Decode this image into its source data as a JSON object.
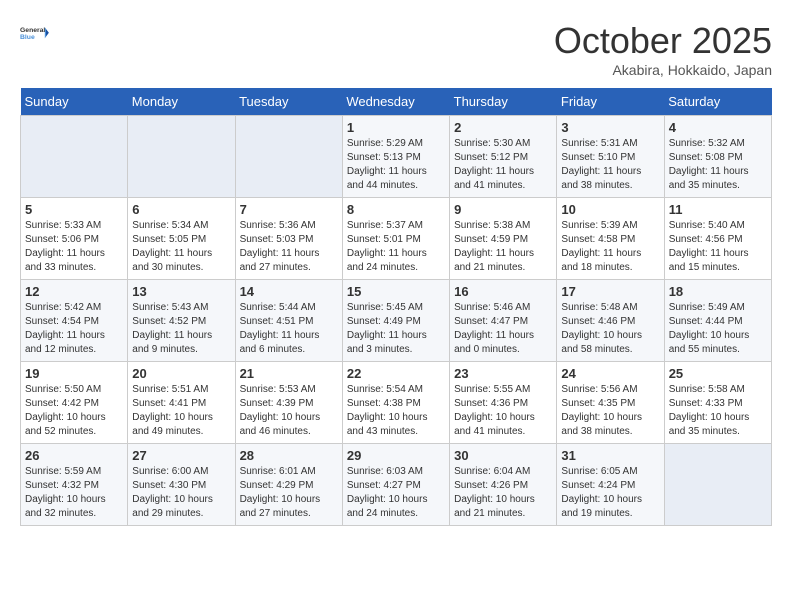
{
  "header": {
    "logo_line1": "General",
    "logo_line2": "Blue",
    "month": "October 2025",
    "location": "Akabira, Hokkaido, Japan"
  },
  "weekdays": [
    "Sunday",
    "Monday",
    "Tuesday",
    "Wednesday",
    "Thursday",
    "Friday",
    "Saturday"
  ],
  "weeks": [
    [
      {
        "day": "",
        "info": ""
      },
      {
        "day": "",
        "info": ""
      },
      {
        "day": "",
        "info": ""
      },
      {
        "day": "1",
        "info": "Sunrise: 5:29 AM\nSunset: 5:13 PM\nDaylight: 11 hours and 44 minutes."
      },
      {
        "day": "2",
        "info": "Sunrise: 5:30 AM\nSunset: 5:12 PM\nDaylight: 11 hours and 41 minutes."
      },
      {
        "day": "3",
        "info": "Sunrise: 5:31 AM\nSunset: 5:10 PM\nDaylight: 11 hours and 38 minutes."
      },
      {
        "day": "4",
        "info": "Sunrise: 5:32 AM\nSunset: 5:08 PM\nDaylight: 11 hours and 35 minutes."
      }
    ],
    [
      {
        "day": "5",
        "info": "Sunrise: 5:33 AM\nSunset: 5:06 PM\nDaylight: 11 hours and 33 minutes."
      },
      {
        "day": "6",
        "info": "Sunrise: 5:34 AM\nSunset: 5:05 PM\nDaylight: 11 hours and 30 minutes."
      },
      {
        "day": "7",
        "info": "Sunrise: 5:36 AM\nSunset: 5:03 PM\nDaylight: 11 hours and 27 minutes."
      },
      {
        "day": "8",
        "info": "Sunrise: 5:37 AM\nSunset: 5:01 PM\nDaylight: 11 hours and 24 minutes."
      },
      {
        "day": "9",
        "info": "Sunrise: 5:38 AM\nSunset: 4:59 PM\nDaylight: 11 hours and 21 minutes."
      },
      {
        "day": "10",
        "info": "Sunrise: 5:39 AM\nSunset: 4:58 PM\nDaylight: 11 hours and 18 minutes."
      },
      {
        "day": "11",
        "info": "Sunrise: 5:40 AM\nSunset: 4:56 PM\nDaylight: 11 hours and 15 minutes."
      }
    ],
    [
      {
        "day": "12",
        "info": "Sunrise: 5:42 AM\nSunset: 4:54 PM\nDaylight: 11 hours and 12 minutes."
      },
      {
        "day": "13",
        "info": "Sunrise: 5:43 AM\nSunset: 4:52 PM\nDaylight: 11 hours and 9 minutes."
      },
      {
        "day": "14",
        "info": "Sunrise: 5:44 AM\nSunset: 4:51 PM\nDaylight: 11 hours and 6 minutes."
      },
      {
        "day": "15",
        "info": "Sunrise: 5:45 AM\nSunset: 4:49 PM\nDaylight: 11 hours and 3 minutes."
      },
      {
        "day": "16",
        "info": "Sunrise: 5:46 AM\nSunset: 4:47 PM\nDaylight: 11 hours and 0 minutes."
      },
      {
        "day": "17",
        "info": "Sunrise: 5:48 AM\nSunset: 4:46 PM\nDaylight: 10 hours and 58 minutes."
      },
      {
        "day": "18",
        "info": "Sunrise: 5:49 AM\nSunset: 4:44 PM\nDaylight: 10 hours and 55 minutes."
      }
    ],
    [
      {
        "day": "19",
        "info": "Sunrise: 5:50 AM\nSunset: 4:42 PM\nDaylight: 10 hours and 52 minutes."
      },
      {
        "day": "20",
        "info": "Sunrise: 5:51 AM\nSunset: 4:41 PM\nDaylight: 10 hours and 49 minutes."
      },
      {
        "day": "21",
        "info": "Sunrise: 5:53 AM\nSunset: 4:39 PM\nDaylight: 10 hours and 46 minutes."
      },
      {
        "day": "22",
        "info": "Sunrise: 5:54 AM\nSunset: 4:38 PM\nDaylight: 10 hours and 43 minutes."
      },
      {
        "day": "23",
        "info": "Sunrise: 5:55 AM\nSunset: 4:36 PM\nDaylight: 10 hours and 41 minutes."
      },
      {
        "day": "24",
        "info": "Sunrise: 5:56 AM\nSunset: 4:35 PM\nDaylight: 10 hours and 38 minutes."
      },
      {
        "day": "25",
        "info": "Sunrise: 5:58 AM\nSunset: 4:33 PM\nDaylight: 10 hours and 35 minutes."
      }
    ],
    [
      {
        "day": "26",
        "info": "Sunrise: 5:59 AM\nSunset: 4:32 PM\nDaylight: 10 hours and 32 minutes."
      },
      {
        "day": "27",
        "info": "Sunrise: 6:00 AM\nSunset: 4:30 PM\nDaylight: 10 hours and 29 minutes."
      },
      {
        "day": "28",
        "info": "Sunrise: 6:01 AM\nSunset: 4:29 PM\nDaylight: 10 hours and 27 minutes."
      },
      {
        "day": "29",
        "info": "Sunrise: 6:03 AM\nSunset: 4:27 PM\nDaylight: 10 hours and 24 minutes."
      },
      {
        "day": "30",
        "info": "Sunrise: 6:04 AM\nSunset: 4:26 PM\nDaylight: 10 hours and 21 minutes."
      },
      {
        "day": "31",
        "info": "Sunrise: 6:05 AM\nSunset: 4:24 PM\nDaylight: 10 hours and 19 minutes."
      },
      {
        "day": "",
        "info": ""
      }
    ]
  ]
}
